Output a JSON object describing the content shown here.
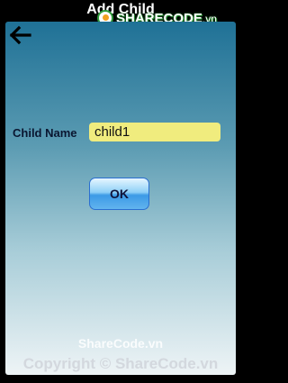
{
  "header": {
    "title": "Add Child",
    "back_icon": "arrow-left-icon"
  },
  "logo": {
    "brand": "SHARECODE",
    "suffix": ".vn",
    "icon": "sharecode-logo-icon"
  },
  "form": {
    "child_name_label": "Child Name",
    "child_name_value": "child1",
    "ok_label": "OK",
    "field_color": "#f0ec7e"
  },
  "watermark": {
    "site": "ShareCode.vn",
    "copyright": "Copyright © ShareCode.vn"
  },
  "colors": {
    "gradient_top": "#1f7196",
    "gradient_bottom": "#eef4f6",
    "button_accent": "#3c9ae6"
  }
}
